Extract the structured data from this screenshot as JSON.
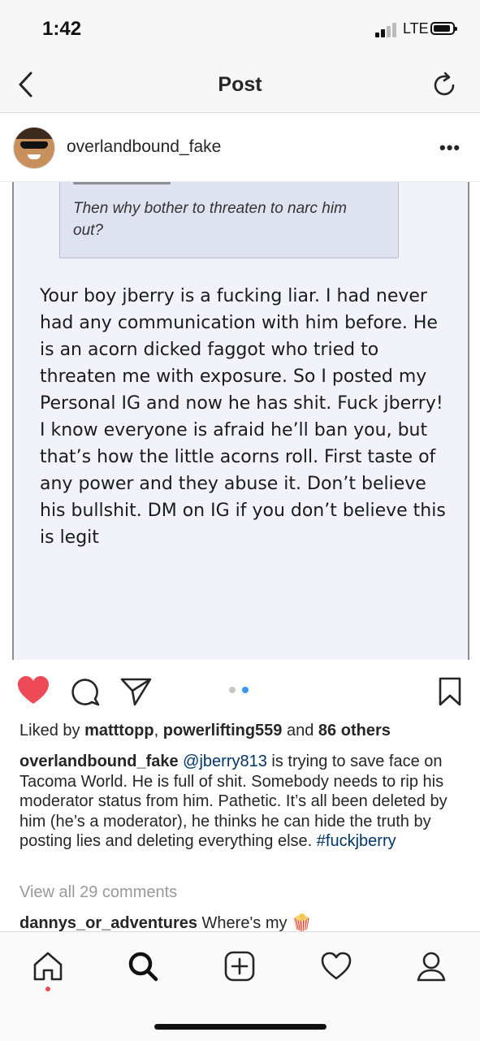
{
  "status": {
    "time": "1:42",
    "network": "LTE"
  },
  "nav": {
    "title": "Post"
  },
  "post": {
    "username": "overlandbound_fake",
    "image": {
      "quote": "Then why bother to threaten to narc him out?",
      "body": "Your boy jberry is a fucking liar. I had never had any communication with him before. He is an acorn dicked faggot who tried to threaten me with exposure. So I posted my Personal IG and now he has shit. Fuck jberry! I know everyone is afraid he’ll ban you, but that’s how the little acorns roll. First taste of any power and they abuse it. Don’t believe his bullshit. DM on IG if you don’t believe this is legit"
    },
    "carousel": {
      "count": 2,
      "active": 2
    },
    "likes": {
      "prefix": "Liked by ",
      "user1": "matttopp",
      "separator": ", ",
      "user2": "powerlifting559",
      "joiner": " and ",
      "others": "86 others"
    },
    "caption": {
      "username": "overlandbound_fake",
      "mention": "@jberry813",
      "text": " is trying to save face on Tacoma World. He is full of shit. Somebody needs to rip his moderator status from him. Pathetic. It’s all been deleted by him (he’s a moderator), he thinks he can hide the truth by posting lies and deleting everything else. ",
      "hashtag": "#fuckjberry"
    },
    "view_comments": "View all 29 comments",
    "comment": {
      "username": "dannys_or_adventures",
      "text": " Where's my ",
      "emoji": "🍿"
    }
  },
  "colors": {
    "like_red": "#ed4956",
    "link_blue": "#003569",
    "carousel_active": "#3897f0",
    "carousel_inactive": "#c7c7c7"
  },
  "icons": [
    "back-icon",
    "refresh-icon",
    "more-icon",
    "heart-icon",
    "comment-icon",
    "share-icon",
    "bookmark-icon",
    "home-icon",
    "search-icon",
    "new-post-icon",
    "activity-icon",
    "profile-icon"
  ]
}
